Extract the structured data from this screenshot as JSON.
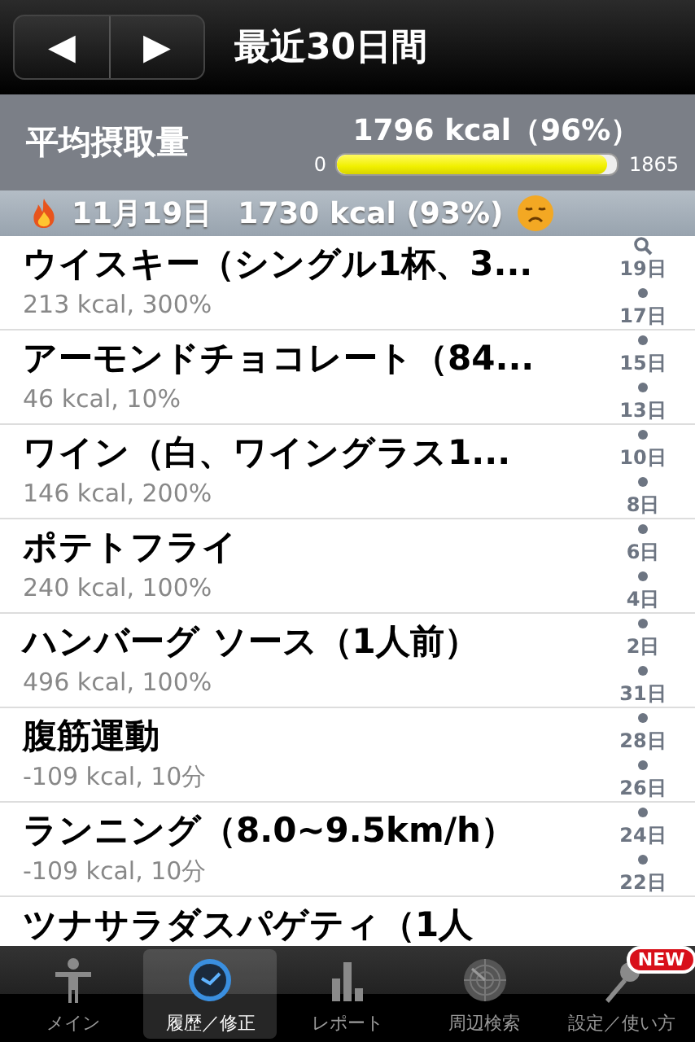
{
  "nav_bar": {
    "prev_button": "◀",
    "next_button": "▶",
    "title": "最近30日間"
  },
  "summary": {
    "label": "平均摂取量",
    "value": "1796 kcal（96%）",
    "min": "0",
    "max": "1865",
    "level": 0.963
  },
  "section_header": {
    "date": "11月19日",
    "total": "1730 kcal (93%)"
  },
  "entries": [
    {
      "name": "ウイスキー（シングル1杯、3...",
      "detail": "213 kcal, 300%"
    },
    {
      "name": "アーモンドチョコレート（84...",
      "detail": "46 kcal, 10%"
    },
    {
      "name": "ワイン（白、ワイングラス1...",
      "detail": "146 kcal, 200%"
    },
    {
      "name": "ポテトフライ",
      "detail": "240 kcal, 100%"
    },
    {
      "name": "ハンバーグ ソース（1人前）",
      "detail": "496 kcal, 100%"
    },
    {
      "name": "腹筋運動",
      "detail": "-109 kcal, 10分"
    },
    {
      "name": "ランニング（8.0~9.5km/h）",
      "detail": "-109 kcal, 10分"
    },
    {
      "name": "ツナサラダスパゲティ（1人"
    }
  ],
  "index": [
    "19日",
    "17日",
    "15日",
    "13日",
    "10日",
    "8日",
    "6日",
    "4日",
    "2日",
    "31日",
    "28日",
    "26日",
    "24日",
    "22日"
  ],
  "tab_bar": [
    {
      "label": "メイン",
      "selected": false
    },
    {
      "label": "履歴／修正",
      "selected": true
    },
    {
      "label": "レポート",
      "selected": false
    },
    {
      "label": "周辺検索",
      "selected": false
    },
    {
      "label": "設定／使い方",
      "selected": false,
      "badge": "NEW"
    }
  ]
}
